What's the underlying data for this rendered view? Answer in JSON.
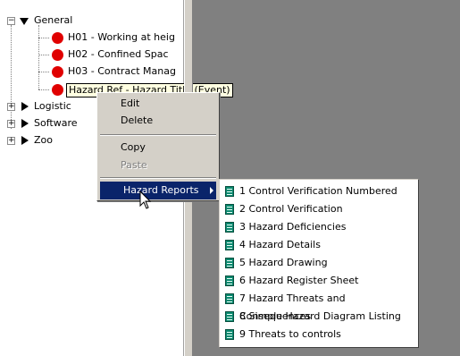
{
  "tree": {
    "general": {
      "label": "General",
      "expander": "−"
    },
    "hazards": [
      {
        "label": "H01 - Working at heig"
      },
      {
        "label": "H02 - Confined Spac"
      },
      {
        "label": "H03 - Contract Manag"
      }
    ],
    "new_hazard": {
      "label": "Hazard Ref - Hazard Title (Event)"
    },
    "folders": [
      {
        "label": "Logistic",
        "expander": "+"
      },
      {
        "label": "Software",
        "expander": "+"
      },
      {
        "label": "Zoo",
        "expander": "+"
      }
    ]
  },
  "context_menu": {
    "edit": "Edit",
    "delete": "Delete",
    "copy": "Copy",
    "paste": "Paste",
    "hazard_reports": "Hazard Reports"
  },
  "reports_submenu": [
    {
      "label": "1 Control Verification Numbered"
    },
    {
      "label": "2 Control Verification"
    },
    {
      "label": "3 Hazard Deficiencies"
    },
    {
      "label": "4 Hazard Details"
    },
    {
      "label": "5 Hazard Drawing"
    },
    {
      "label": "6 Hazard Register Sheet"
    },
    {
      "label": "7 Hazard Threats and Consequences"
    },
    {
      "label": "8 Simple Hazard Diagram Listing"
    },
    {
      "label": "9 Threats to controls"
    }
  ],
  "colors": {
    "hazard_dot": "#e00000",
    "menu_highlight": "#0a246a",
    "report_icon": "#0b8a70",
    "workspace": "#808080"
  },
  "icons": {
    "hazard": "red-circle-icon",
    "report": "report-document-icon",
    "folder_open": "triangle-down-icon",
    "folder_closed": "triangle-right-icon",
    "cursor": "mouse-pointer-icon"
  }
}
